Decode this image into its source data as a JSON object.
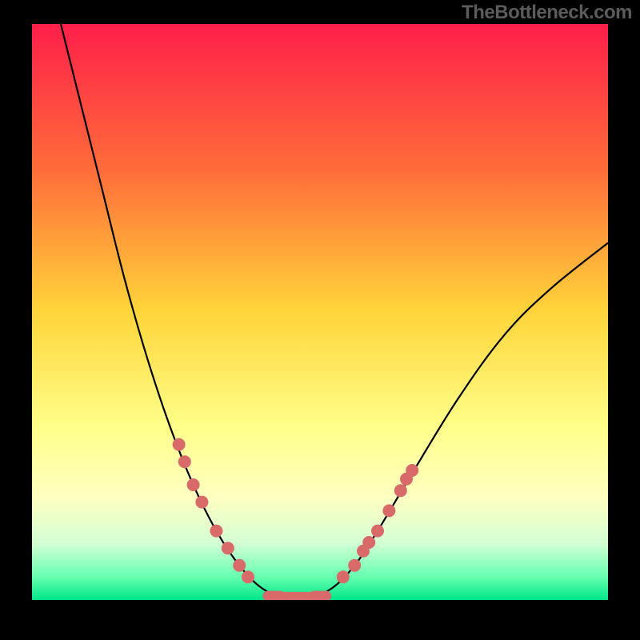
{
  "watermark": "TheBottleneck.com",
  "chart_data": {
    "type": "line",
    "title": "",
    "xlabel": "",
    "ylabel": "",
    "x_range": [
      0,
      100
    ],
    "y_range": [
      0,
      100
    ],
    "background_gradient_stops": [
      {
        "offset": 0,
        "color": "#ff1f4a"
      },
      {
        "offset": 0.25,
        "color": "#ff6b3a"
      },
      {
        "offset": 0.5,
        "color": "#ffd53a"
      },
      {
        "offset": 0.7,
        "color": "#ffff8a"
      },
      {
        "offset": 0.82,
        "color": "#ffffc0"
      },
      {
        "offset": 0.9,
        "color": "#d5ffd5"
      },
      {
        "offset": 0.96,
        "color": "#66ffb0"
      },
      {
        "offset": 1.0,
        "color": "#00e589"
      }
    ],
    "series": [
      {
        "name": "bottleneck-curve",
        "points": [
          {
            "x": 5,
            "y": 100
          },
          {
            "x": 8,
            "y": 88
          },
          {
            "x": 12,
            "y": 72
          },
          {
            "x": 16,
            "y": 56
          },
          {
            "x": 20,
            "y": 42
          },
          {
            "x": 24,
            "y": 30
          },
          {
            "x": 28,
            "y": 20
          },
          {
            "x": 32,
            "y": 12
          },
          {
            "x": 36,
            "y": 6
          },
          {
            "x": 40,
            "y": 2
          },
          {
            "x": 44,
            "y": 0.5
          },
          {
            "x": 48,
            "y": 0.5
          },
          {
            "x": 52,
            "y": 2
          },
          {
            "x": 56,
            "y": 6
          },
          {
            "x": 60,
            "y": 12
          },
          {
            "x": 66,
            "y": 22
          },
          {
            "x": 74,
            "y": 35
          },
          {
            "x": 82,
            "y": 46
          },
          {
            "x": 90,
            "y": 54
          },
          {
            "x": 100,
            "y": 62
          }
        ]
      }
    ],
    "marker_groups": [
      {
        "name": "left-branch-markers",
        "color": "#d86a6a",
        "points": [
          {
            "x": 25.5,
            "y": 27
          },
          {
            "x": 26.5,
            "y": 24
          },
          {
            "x": 28,
            "y": 20
          },
          {
            "x": 29.5,
            "y": 17
          },
          {
            "x": 32,
            "y": 12
          },
          {
            "x": 34,
            "y": 9
          },
          {
            "x": 36,
            "y": 6
          },
          {
            "x": 37.5,
            "y": 4
          }
        ]
      },
      {
        "name": "right-branch-markers",
        "color": "#d86a6a",
        "points": [
          {
            "x": 54,
            "y": 4
          },
          {
            "x": 56,
            "y": 6
          },
          {
            "x": 57.5,
            "y": 8.5
          },
          {
            "x": 58.5,
            "y": 10
          },
          {
            "x": 60,
            "y": 12
          },
          {
            "x": 62,
            "y": 15.5
          },
          {
            "x": 64,
            "y": 19
          },
          {
            "x": 65,
            "y": 21
          },
          {
            "x": 66,
            "y": 22.5
          }
        ]
      },
      {
        "name": "bottom-flat-markers",
        "color": "#d86a6a",
        "shape": "pill",
        "points": [
          {
            "x": 42,
            "y": 0.7
          },
          {
            "x": 44,
            "y": 0.5
          },
          {
            "x": 46,
            "y": 0.5
          },
          {
            "x": 48,
            "y": 0.5
          },
          {
            "x": 50,
            "y": 0.7
          }
        ]
      }
    ]
  }
}
